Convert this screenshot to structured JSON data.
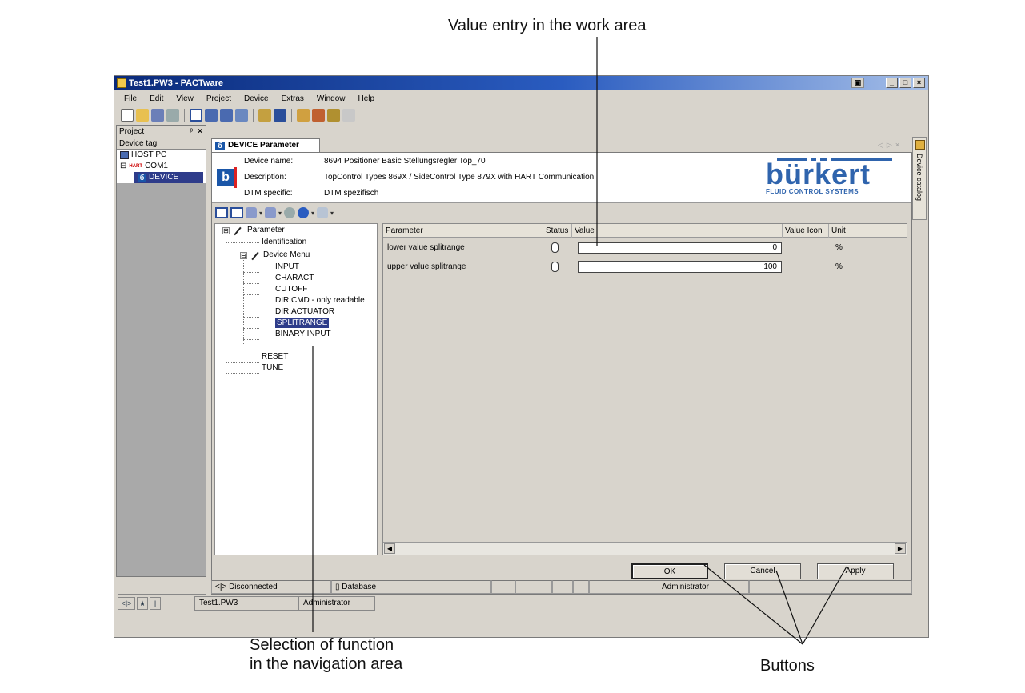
{
  "callouts": {
    "value_entry": "Value entry in the work area",
    "nav_line1": "Selection of function",
    "nav_line2": "in the navigation area",
    "buttons": "Buttons"
  },
  "window": {
    "title": "Test1.PW3 - PACTware",
    "controls": [
      "_",
      "□",
      "×"
    ]
  },
  "menu": [
    "File",
    "Edit",
    "View",
    "Project",
    "Device",
    "Extras",
    "Window",
    "Help"
  ],
  "project": {
    "title": "Project",
    "pin": "ᵖ",
    "close": "×",
    "column": "Device tag",
    "items": [
      {
        "label": "HOST PC",
        "icon": "pc-icon"
      },
      {
        "label": "COM1",
        "icon": "hart-icon",
        "badge": "HART",
        "expander": "⊟"
      },
      {
        "label": "DEVICE",
        "icon": "b-icon"
      }
    ]
  },
  "catalog": {
    "label": "Device catalog"
  },
  "doc": {
    "tab_label": "DEVICE Parameter",
    "tab_icon": "б",
    "header": {
      "rows": [
        {
          "label": "Device name:",
          "value": "8694 Positioner Basic Stellungsregler Top_70"
        },
        {
          "label": "Description:",
          "value": "TopControl Types 869X / SideControl Type 879X  with HART Communication"
        },
        {
          "label": "DTM specific:",
          "value": "DTM spezifisch"
        }
      ],
      "logo": "b",
      "brand_name": "bürkert",
      "brand_sub": "FLUID CONTROL SYSTEMS"
    }
  },
  "nav": {
    "items": [
      "Parameter",
      "Identification",
      "Device Menu",
      "INPUT",
      "CHARACT",
      "CUTOFF",
      "DIR.CMD - only readable",
      "DIR.ACTUATOR",
      "SPLITRANGE",
      "BINARY INPUT",
      "RESET",
      "TUNE"
    ],
    "selected": "SPLITRANGE",
    "expander": "⊟"
  },
  "grid": {
    "columns": [
      "Parameter",
      "Status",
      "Value",
      "Value Icon",
      "Unit"
    ],
    "rows": [
      {
        "param": "lower value splitrange",
        "value": "0",
        "unit": "%"
      },
      {
        "param": "upper value splitrange",
        "value": "100",
        "unit": "%"
      }
    ],
    "scroll_left": "◀",
    "scroll_right": "▶"
  },
  "buttons": {
    "ok": "OK",
    "cancel": "Cancel",
    "apply": "Apply"
  },
  "doc_status": {
    "connection": "Disconnected",
    "connection_icon": "<|>",
    "database": "Database",
    "user": "Administrator"
  },
  "main_status": {
    "file": "Test1.PW3",
    "user": "Administrator"
  }
}
